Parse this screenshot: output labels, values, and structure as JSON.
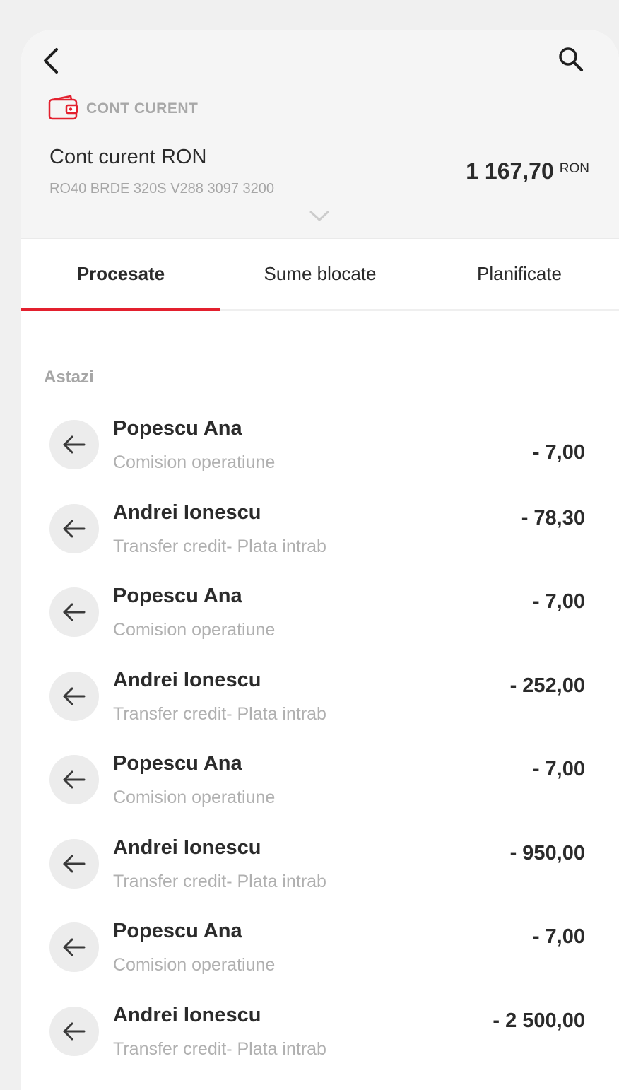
{
  "header": {
    "account_type": "CONT CURENT",
    "account_name": "Cont curent RON",
    "iban": "RO40 BRDE 320S V288 3097 3200",
    "balance_amount": "1 167,70",
    "balance_currency": "RON"
  },
  "tabs": [
    {
      "label": "Procesate",
      "active": true
    },
    {
      "label": "Sume blocate",
      "active": false
    },
    {
      "label": "Planificate",
      "active": false
    }
  ],
  "section": {
    "label": "Astazi"
  },
  "transactions": [
    {
      "name": "Popescu Ana",
      "description": "Comision operatiune",
      "amount": "- 7,00"
    },
    {
      "name": "Andrei Ionescu",
      "description": "Transfer credit- Plata intrab",
      "amount": "- 78,30"
    },
    {
      "name": "Popescu Ana",
      "description": "Comision operatiune",
      "amount": "- 7,00"
    },
    {
      "name": "Andrei Ionescu",
      "description": "Transfer credit- Plata intrab",
      "amount": "- 252,00"
    },
    {
      "name": "Popescu Ana",
      "description": "Comision operatiune",
      "amount": "- 7,00"
    },
    {
      "name": "Andrei Ionescu",
      "description": "Transfer credit- Plata intrab",
      "amount": "- 950,00"
    },
    {
      "name": "Popescu Ana",
      "description": "Comision operatiune",
      "amount": "- 7,00"
    },
    {
      "name": "Andrei Ionescu",
      "description": "Transfer credit- Plata intrab",
      "amount": "- 2 500,00"
    }
  ],
  "icons": {
    "back": "chevron-left-icon",
    "search": "search-icon",
    "account": "wallet-icon",
    "expand": "chevron-down-icon",
    "transaction": "arrow-left-icon"
  },
  "colors": {
    "accent": "#e3202e",
    "text": "#2b2b2b",
    "muted": "#a6a6a6",
    "header_bg": "#f5f5f5"
  }
}
